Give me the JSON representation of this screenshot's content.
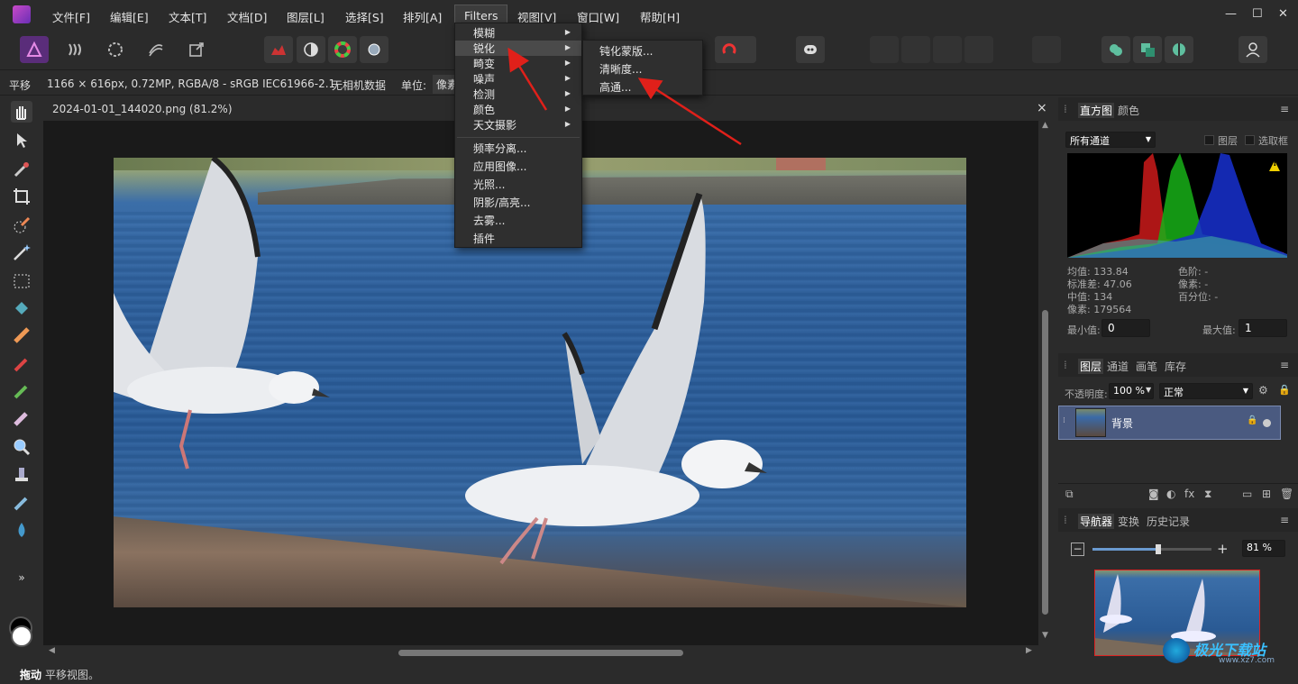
{
  "menubar": {
    "items": [
      "文件[F]",
      "编辑[E]",
      "文本[T]",
      "文档[D]",
      "图层[L]",
      "选择[S]",
      "排列[A]",
      "Filters",
      "视图[V]",
      "窗口[W]",
      "帮助[H]"
    ]
  },
  "context_bar": {
    "tool": "平移",
    "info": "1166 × 616px, 0.72MP, RGBA/8 - sRGB IEC61966-2.1",
    "camera": "无相机数据",
    "unit_label": "单位:",
    "unit_value": "像素"
  },
  "document": {
    "tab_title": "2024-01-01_144020.png (81.2%)",
    "close": "×"
  },
  "filters_menu": {
    "items": [
      "模糊",
      "锐化",
      "畸变",
      "噪声",
      "检测",
      "颜色",
      "天文摄影",
      "频率分离...",
      "应用图像...",
      "光照...",
      "阴影/高亮...",
      "去雾...",
      "插件"
    ],
    "highlighted": "锐化"
  },
  "sharpen_submenu": {
    "items": [
      "钝化蒙版...",
      "清晰度...",
      "高通..."
    ]
  },
  "histogram_panel": {
    "tabs": [
      "直方图",
      "颜色"
    ],
    "channel": "所有通道",
    "check_layer": "图层",
    "check_marquee": "选取框",
    "stats_left": [
      "均值: 133.84",
      "标准差: 47.06",
      "中值: 134",
      "像素: 179564"
    ],
    "stats_right": [
      "色阶: -",
      "像素: -",
      "百分位: -"
    ],
    "min_label": "最小值:",
    "min_value": "0",
    "max_label": "最大值:",
    "max_value": "1"
  },
  "layers_panel": {
    "tabs": [
      "图层",
      "通道",
      "画笔",
      "库存"
    ],
    "opacity_label": "不透明度:",
    "opacity_value": "100 %",
    "blend_mode": "正常",
    "layer_name": "背景"
  },
  "navigator_panel": {
    "tabs": [
      "导航器",
      "变换",
      "历史记录"
    ],
    "zoom": "81 %",
    "zoom_fraction": 0.55
  },
  "statusbar": {
    "bold": "拖动",
    "text": "平移视图。"
  },
  "watermark": {
    "text": "极光下载站",
    "url": "www.xz7.com"
  },
  "colors": {
    "accent": "#4a5a80",
    "arrow": "#e0201a",
    "menu_bg": "#2f2f2f"
  }
}
